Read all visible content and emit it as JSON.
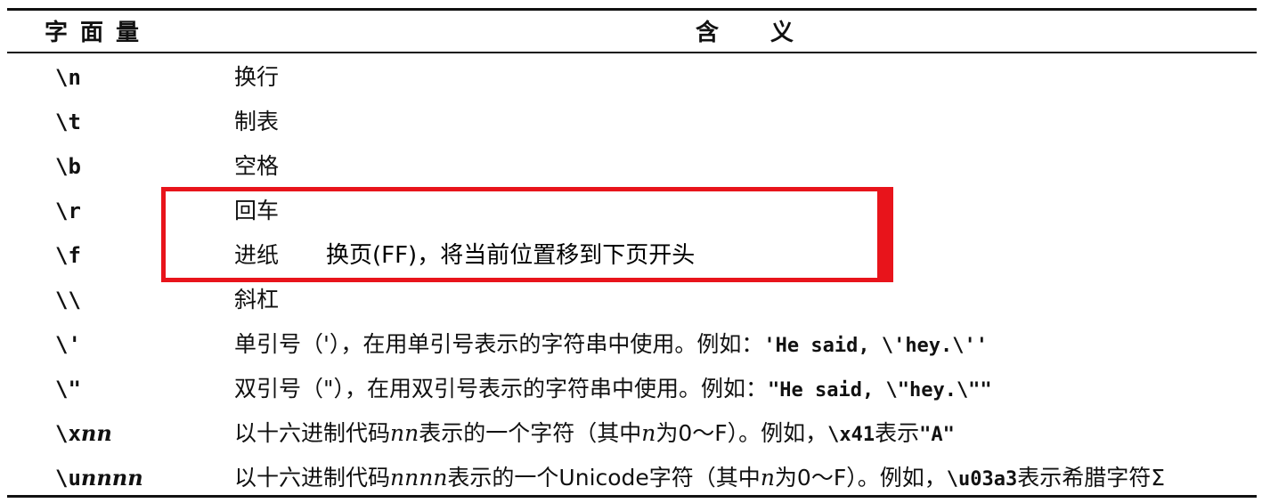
{
  "header": {
    "col1": "字面量",
    "col2": "含义"
  },
  "rows": [
    {
      "literal": "\\n",
      "meaning": "换行"
    },
    {
      "literal": "\\t",
      "meaning": "制表"
    },
    {
      "literal": "\\b",
      "meaning": "空格"
    },
    {
      "literal": "\\r",
      "meaning": "回车"
    },
    {
      "literal": "\\f",
      "meaning": "进纸"
    },
    {
      "literal": "\\\\",
      "meaning": "斜杠"
    },
    {
      "literal": "\\'",
      "meaning_prefix": "单引号（'），在用单引号表示的字符串中使用。例如：",
      "meaning_code": "'He said, \\'hey.\\''"
    },
    {
      "literal": "\\\"",
      "meaning_prefix": "双引号（\"），在用双引号表示的字符串中使用。例如：",
      "meaning_code": "\"He said, \\\"hey.\\\"\""
    },
    {
      "literal_prefix": "\\x",
      "literal_italic": "nn",
      "meaning_a": "以十六进制代码",
      "meaning_it": "nn",
      "meaning_b": "表示的一个字符（其中",
      "meaning_n": "n",
      "meaning_c": "为0～F）。例如，",
      "meaning_code": "\\x41",
      "meaning_d": "表示",
      "meaning_code2": "\"A\""
    },
    {
      "literal_prefix": "\\u",
      "literal_italic": "nnnn",
      "meaning_a": "以十六进制代码",
      "meaning_it": "nnnn",
      "meaning_b": "表示的一个Unicode字符（其中",
      "meaning_n": "n",
      "meaning_c": "为0～F）。例如，",
      "meaning_code": "\\u03a3",
      "meaning_d": "表示希腊字符Σ"
    }
  ],
  "annotation": {
    "text": "换页(FF)，将当前位置移到下页开头",
    "border_color": "#e8141b"
  }
}
